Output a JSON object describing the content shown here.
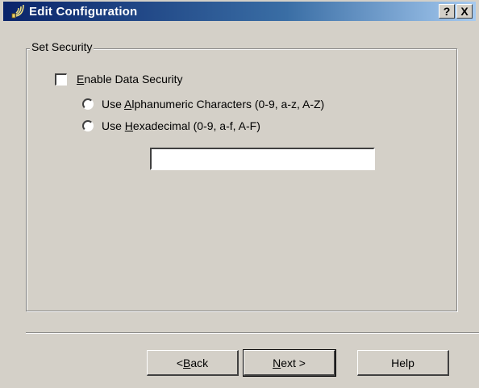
{
  "window": {
    "title": "Edit Configuration",
    "help_button": "?",
    "close_button": "X"
  },
  "group": {
    "legend": "Set Security"
  },
  "checkbox": {
    "mnemonic": "E",
    "label_rest": "nable Data Security",
    "checked": false
  },
  "radio_alnum": {
    "prefix": "Use ",
    "mnemonic": "A",
    "rest": "lphanumeric Characters (0-9, a-z, A-Z)"
  },
  "radio_hex": {
    "prefix": "Use ",
    "mnemonic": "H",
    "rest": "exadecimal (0-9, a-f, A-F)"
  },
  "security_key": {
    "value": ""
  },
  "buttons": {
    "back_prefix": "< ",
    "back_mnemonic": "B",
    "back_rest": "ack",
    "next_mnemonic": "N",
    "next_rest": "ext >",
    "help": "Help"
  },
  "colors": {
    "dialog_bg": "#d4d0c8",
    "titlebar_start": "#0a246a",
    "titlebar_end": "#a6caf0"
  }
}
